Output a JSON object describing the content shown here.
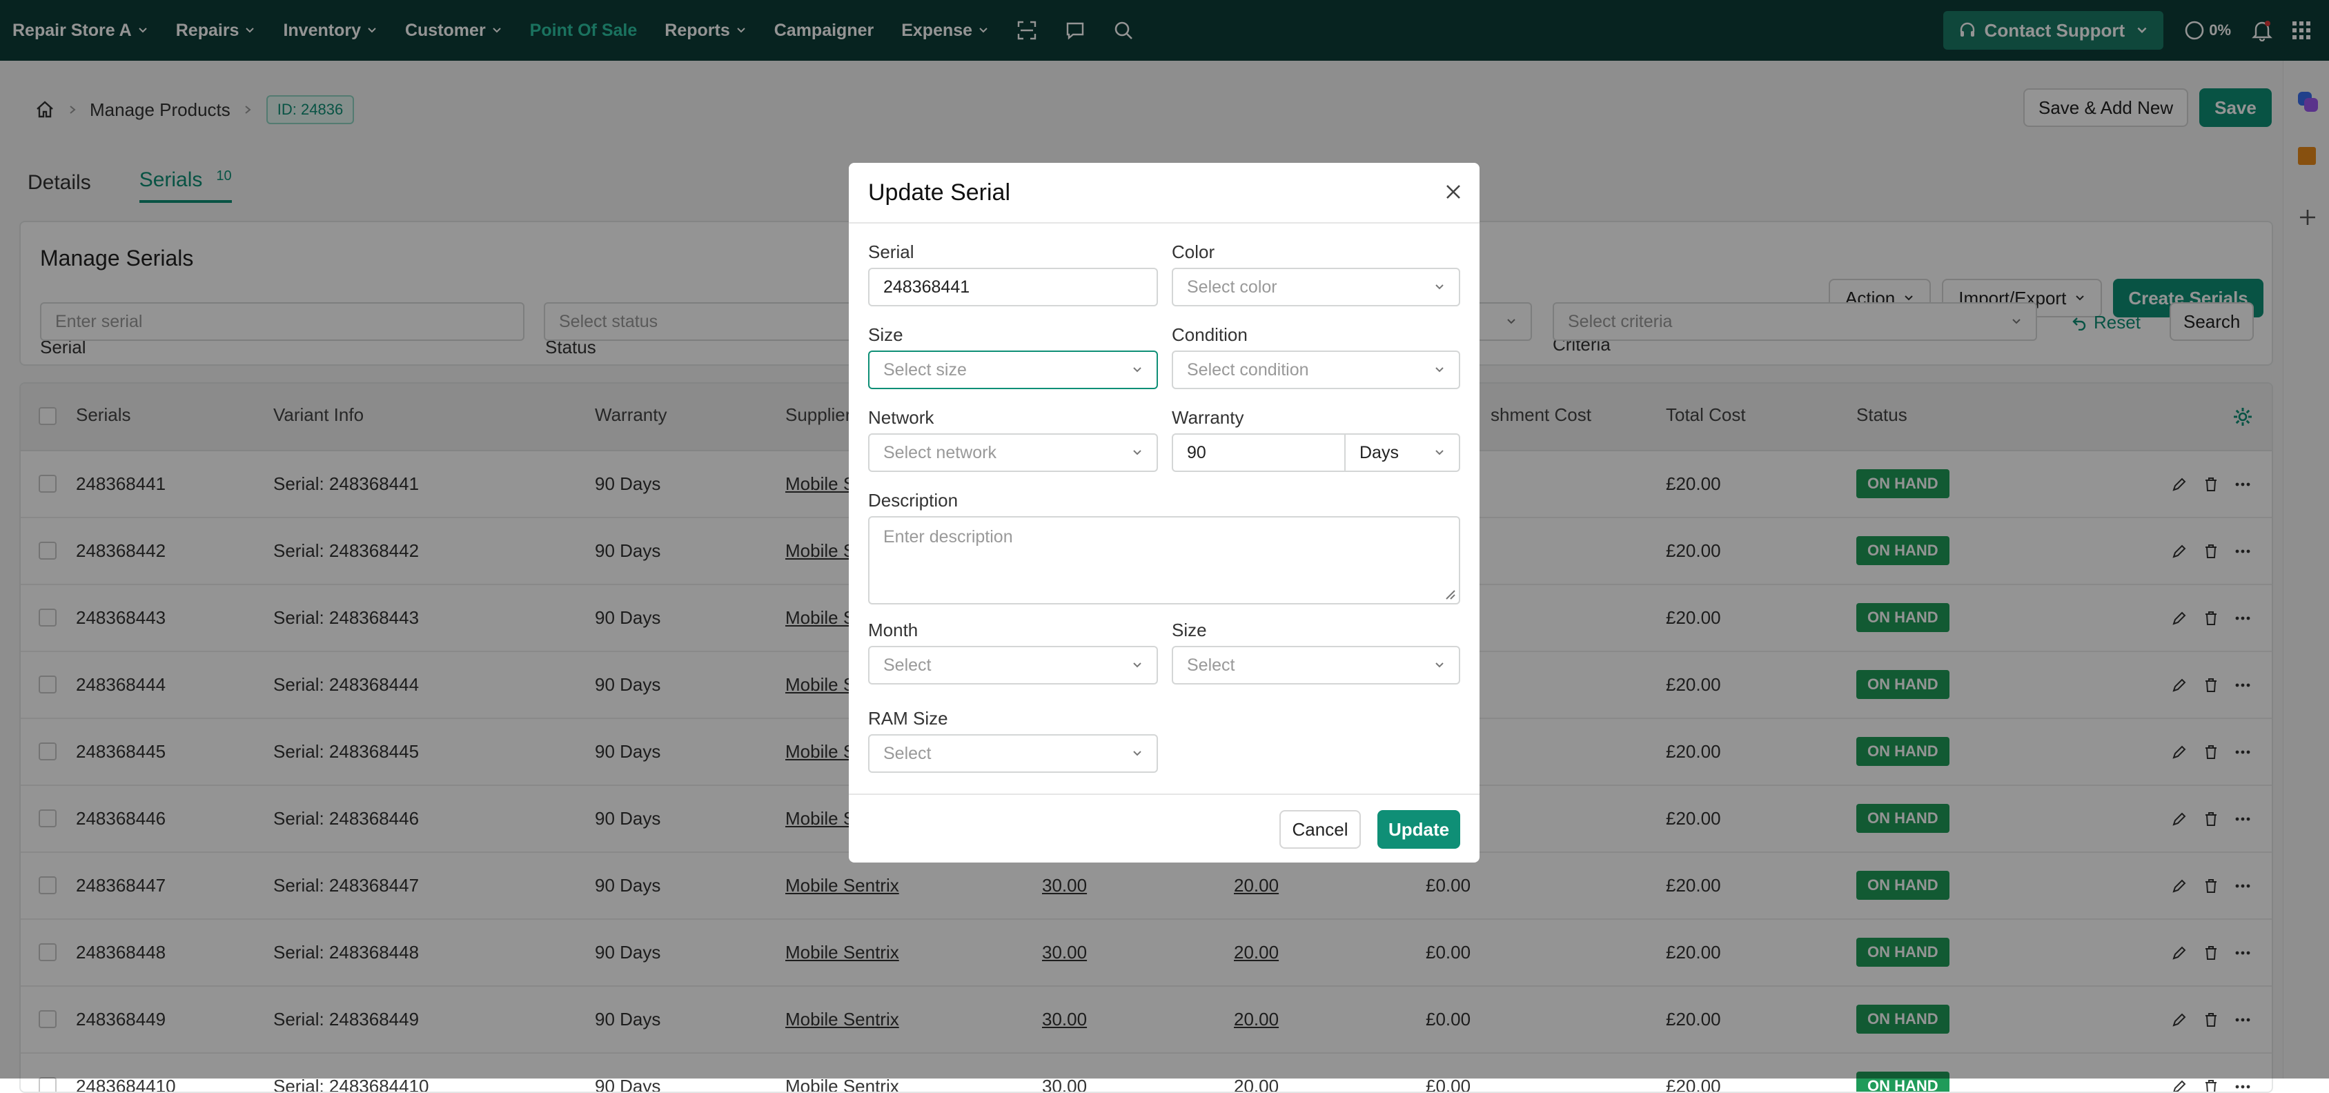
{
  "nav": {
    "store": "Repair Store A",
    "items": [
      "Repairs",
      "Inventory",
      "Customer",
      "Point Of Sale",
      "Reports",
      "Campaigner",
      "Expense"
    ],
    "active": "Point Of Sale",
    "support": "Contact Support",
    "progress": "0%"
  },
  "breadcrumb": {
    "page": "Manage Products",
    "id": "ID: 24836"
  },
  "header_actions": {
    "save_add_new": "Save & Add New",
    "save": "Save"
  },
  "tabs": [
    {
      "label": "Details"
    },
    {
      "label": "Serials",
      "count": "10"
    }
  ],
  "serials_card": {
    "title": "Manage Serials",
    "action": "Action",
    "import_export": "Import/Export",
    "create": "Create Serials",
    "filters": {
      "serial_label": "Serial",
      "serial_placeholder": "Enter serial",
      "status_label": "Status",
      "status_placeholder": "Select status",
      "criteria_label": "Criteria",
      "criteria_placeholder": "Select criteria",
      "reset": "Reset",
      "search": "Search"
    }
  },
  "table": {
    "columns": [
      "Serials",
      "Variant Info",
      "Warranty",
      "Supplier",
      "",
      "",
      "shment Cost",
      "Total Cost",
      "Status"
    ],
    "rows": [
      {
        "serial": "248368441",
        "variant": "Serial: 248368441",
        "warranty": "90 Days",
        "supplier": "Mobile S",
        "c1": "",
        "c2": "",
        "refurb": "",
        "total": "£20.00",
        "status": "ON HAND"
      },
      {
        "serial": "248368442",
        "variant": "Serial: 248368442",
        "warranty": "90 Days",
        "supplier": "Mobile S",
        "c1": "",
        "c2": "",
        "refurb": "",
        "total": "£20.00",
        "status": "ON HAND"
      },
      {
        "serial": "248368443",
        "variant": "Serial: 248368443",
        "warranty": "90 Days",
        "supplier": "Mobile S",
        "c1": "",
        "c2": "",
        "refurb": "",
        "total": "£20.00",
        "status": "ON HAND"
      },
      {
        "serial": "248368444",
        "variant": "Serial: 248368444",
        "warranty": "90 Days",
        "supplier": "Mobile S",
        "c1": "",
        "c2": "",
        "refurb": "",
        "total": "£20.00",
        "status": "ON HAND"
      },
      {
        "serial": "248368445",
        "variant": "Serial: 248368445",
        "warranty": "90 Days",
        "supplier": "Mobile S",
        "c1": "",
        "c2": "",
        "refurb": "",
        "total": "£20.00",
        "status": "ON HAND"
      },
      {
        "serial": "248368446",
        "variant": "Serial: 248368446",
        "warranty": "90 Days",
        "supplier": "Mobile S",
        "c1": "",
        "c2": "",
        "refurb": "",
        "total": "£20.00",
        "status": "ON HAND"
      },
      {
        "serial": "248368447",
        "variant": "Serial: 248368447",
        "warranty": "90 Days",
        "supplier": "Mobile Sentrix",
        "c1": "30.00",
        "c2": "20.00",
        "refurb": "£0.00",
        "total": "£20.00",
        "status": "ON HAND"
      },
      {
        "serial": "248368448",
        "variant": "Serial: 248368448",
        "warranty": "90 Days",
        "supplier": "Mobile Sentrix",
        "c1": "30.00",
        "c2": "20.00",
        "refurb": "£0.00",
        "total": "£20.00",
        "status": "ON HAND"
      },
      {
        "serial": "248368449",
        "variant": "Serial: 248368449",
        "warranty": "90 Days",
        "supplier": "Mobile Sentrix",
        "c1": "30.00",
        "c2": "20.00",
        "refurb": "£0.00",
        "total": "£20.00",
        "status": "ON HAND"
      },
      {
        "serial": "2483684410",
        "variant": "Serial: 2483684410",
        "warranty": "90 Days",
        "supplier": "Mobile Sentrix",
        "c1": "30.00",
        "c2": "20.00",
        "refurb": "£0.00",
        "total": "£20.00",
        "status": "ON HAND"
      }
    ]
  },
  "modal": {
    "title": "Update Serial",
    "serial_label": "Serial",
    "serial_value": "248368441",
    "color_label": "Color",
    "color_placeholder": "Select color",
    "size_label": "Size",
    "size_placeholder": "Select size",
    "condition_label": "Condition",
    "condition_placeholder": "Select condition",
    "network_label": "Network",
    "network_placeholder": "Select network",
    "warranty_label": "Warranty",
    "warranty_value": "90",
    "warranty_unit": "Days",
    "description_label": "Description",
    "description_placeholder": "Enter description",
    "month_label": "Month",
    "month_placeholder": "Select",
    "size2_label": "Size",
    "size2_placeholder": "Select",
    "ram_label": "RAM Size",
    "ram_placeholder": "Select",
    "cancel": "Cancel",
    "update": "Update"
  },
  "colors": {
    "nav_bg": "#0d3d37",
    "accent": "#0f8f76",
    "status_green": "#1f9b59",
    "active_nav": "#2ec4a4"
  }
}
